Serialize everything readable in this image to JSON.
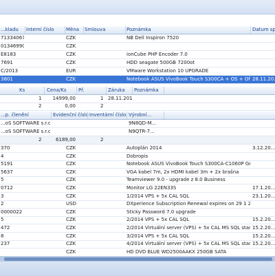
{
  "top_grid": {
    "headers": [
      "...kladu",
      "Interní číslo",
      "Měna",
      "Smlouva",
      "Poznámka",
      "Datum splat..."
    ],
    "rows": [
      {
        "c0": "713340670",
        "c1": "",
        "c2": "CZK",
        "c3": "",
        "c4": "NB Dell Inspiron 7520",
        "c5": ""
      },
      {
        "c0": "013469904",
        "c1": "",
        "c2": "CZK",
        "c3": "",
        "c4": "",
        "c5": ""
      },
      {
        "c0": "E8183",
        "c1": "",
        "c2": "CZK",
        "c3": "",
        "c4": "ionCube PHP Encoder 7.0",
        "c5": ""
      },
      {
        "c0": "7691",
        "c1": "",
        "c2": "CZK",
        "c3": "",
        "c4": "HDD seagate 500GB 7200ot",
        "c5": ""
      },
      {
        "c0": "C/2013",
        "c1": "",
        "c2": "EUR",
        "c3": "",
        "c4": "VMware Workstation 10 UPGRADE",
        "c5": ""
      },
      {
        "c0": "3801",
        "c1": "",
        "c2": "CZK",
        "c3": "",
        "c4": "Notebook ASUS VivoBook Touch S300CA + OS + Office pro...",
        "c5": "28.11.20..."
      }
    ],
    "selected_index": 5
  },
  "items_grid": {
    "headers": [
      "Ks",
      "Cena/Ks",
      "Př.",
      "Záruka",
      "Poznámka"
    ],
    "rows": [
      {
        "ks": "1",
        "cena": "14999,00",
        "pr": "1",
        "zaruka": "28.11.2015",
        "pozn": ""
      },
      {
        "ks": "2",
        "cena": "0,00",
        "pr": "2",
        "zaruka": "",
        "pozn": ""
      }
    ]
  },
  "serials_grid": {
    "headers": [
      "...p. členění",
      "Evidenční číslo",
      "Inventární číslo",
      "Výrobní..."
    ],
    "rows": [
      {
        "a": "...oS SOFTWARE s.r.o.",
        "b": "",
        "c": "",
        "d": "9N8QD-M..."
      },
      {
        "a": "...oS SOFTWARE s.r.o.",
        "b": "",
        "c": "",
        "d": "N9QTR-7..."
      }
    ],
    "summary": {
      "qty": "2",
      "total": "6189,00",
      "count": "2"
    }
  },
  "bottom_grid": {
    "rows": [
      {
        "c0": "370",
        "c1": "CZK",
        "c2": "Autoplán 2014",
        "c3": "3.12.20..."
      },
      {
        "c0": "4",
        "c1": "CZK",
        "c2": "Dobropis",
        "c3": ""
      },
      {
        "c0": "5191",
        "c1": "CZK",
        "c2": "Notebook ASUS VivoBook Touch S300CA-C1060P Grey",
        "c3": ""
      },
      {
        "c0": "5637",
        "c1": "CZK",
        "c2": "VGA kabel 7m, 2x HDMI kabel 3m + 2x brašna",
        "c3": ""
      },
      {
        "c0": "5",
        "c1": "CZK",
        "c2": "Teamviewer 9.0 - upgrade z 8.0 Business",
        "c3": ""
      },
      {
        "c0": "0712",
        "c1": "CZK",
        "c2": "Monitor LG 22EN33S",
        "c3": "17.1.20..."
      },
      {
        "c0": "3",
        "c1": "CZK",
        "c2": "1/2014 VPS + 5x CAL SQL",
        "c3": "23.1.20..."
      },
      {
        "c0": "2",
        "c1": "USD",
        "c2": "DXperience Subscription Renewal expires on 29 1 2015",
        "c3": ""
      },
      {
        "c0": "0000022",
        "c1": "CZK",
        "c2": "Sticky Password 7.0 upgrade",
        "c3": ""
      },
      {
        "c0": "5",
        "c1": "CZK",
        "c2": "2/2014 VPS + 5x CAL SQL",
        "c3": "15.2.20..."
      },
      {
        "c0": "472",
        "c1": "CZK",
        "c2": "2/2014 Virtuální server (VPS) + 5x CAL MS SQL standard",
        "c3": "15.2.20..."
      },
      {
        "c0": "8",
        "c1": "CZK",
        "c2": "3/2014 VPS + 5x CAL SQL",
        "c3": "15.2.20..."
      },
      {
        "c0": "237",
        "c1": "CZK",
        "c2": "4/2014 Virtuální server (VPS) + 5x CAL MS SQL standard",
        "c3": "15.2.20..."
      },
      {
        "c0": "",
        "c1": "CZK",
        "c2": "HD DVD BLUE WD2500AAKX 250GB SATA",
        "c3": ""
      }
    ]
  },
  "colors": {
    "selection": "#3875d7",
    "header_text": "#15428b",
    "chrome": "#d3e0f3"
  }
}
